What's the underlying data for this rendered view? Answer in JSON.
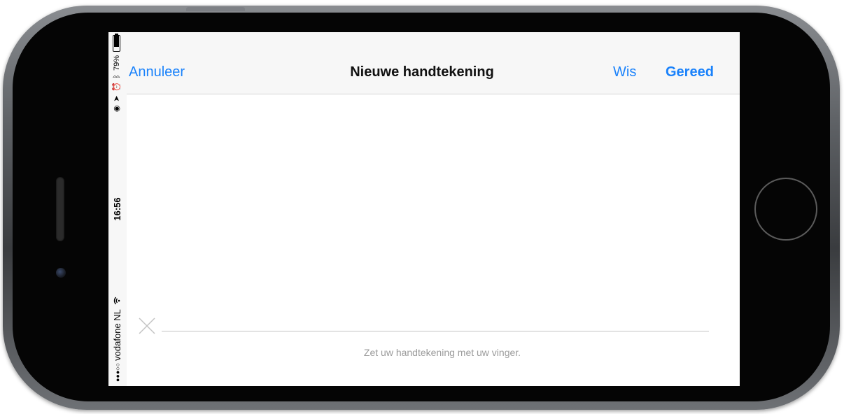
{
  "status_bar": {
    "signal": "●●●○○",
    "carrier": "vodafone NL",
    "wifi_icon": "wifi-icon",
    "time": "16:56",
    "battery_percent": "79%",
    "battery_level": 0.79
  },
  "nav": {
    "cancel_label": "Annuleer",
    "title": "Nieuwe handtekening",
    "clear_label": "Wis",
    "done_label": "Gereed"
  },
  "signature": {
    "hint": "Zet uw handtekening met uw vinger."
  },
  "colors": {
    "accent": "#1a82fb",
    "hint": "#9b9b9b",
    "line": "#c4c4c4"
  }
}
